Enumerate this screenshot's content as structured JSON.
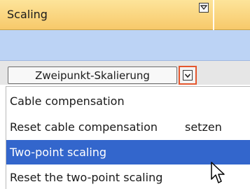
{
  "header": {
    "title": "Scaling",
    "dropdown_icon": "filter-dropdown-icon"
  },
  "toolbar": {
    "combo_value": "Zweipunkt-Skalierung",
    "combo_button_icon": "chevron-down-icon",
    "highlight_color": "#e4572e"
  },
  "dropdown": {
    "selected_color": "#3366cc",
    "items": [
      {
        "label": "Cable compensation"
      },
      {
        "label": "Reset cable compensation",
        "overlap_text": "setzen"
      },
      {
        "label": "Two-point scaling",
        "selected": true
      },
      {
        "label": "Reset the two-point scaling"
      }
    ]
  },
  "cursor": {
    "icon": "mouse-pointer-icon"
  }
}
